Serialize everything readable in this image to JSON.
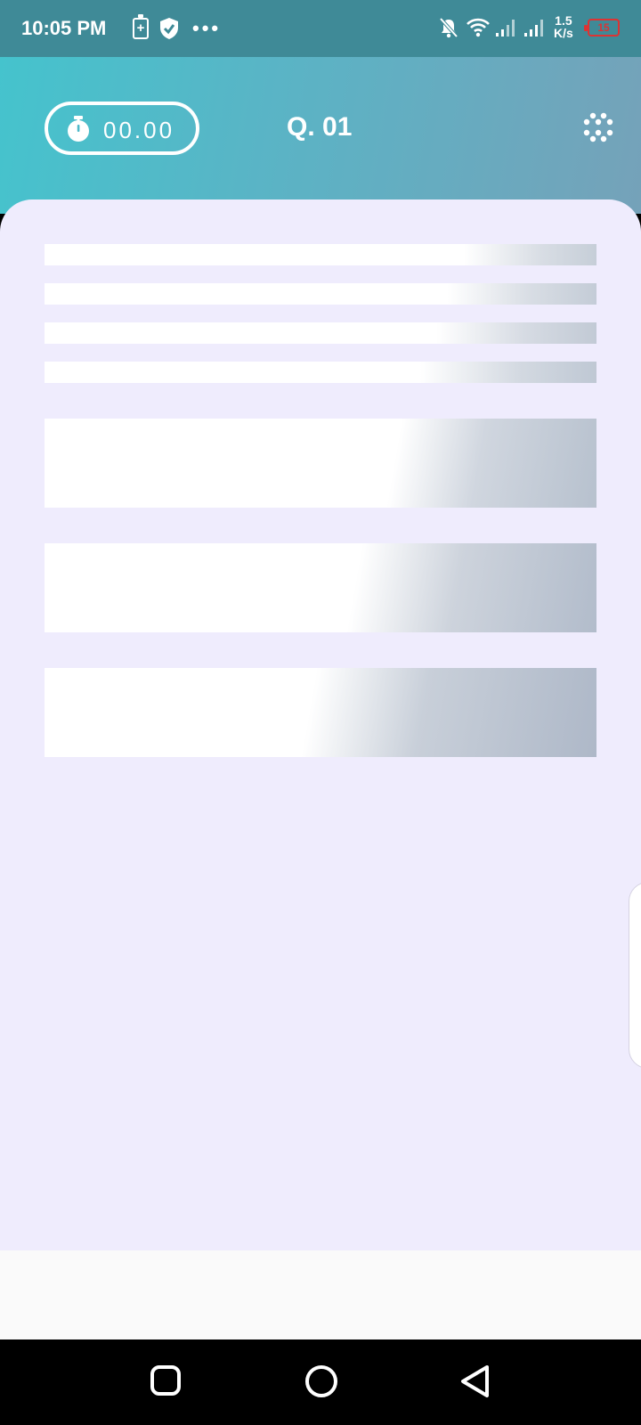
{
  "status_bar": {
    "time": "10:05 PM",
    "battery_saver_symbol": "+",
    "more_dots": "•••",
    "net_speed_value": "1.5",
    "net_speed_unit": "K/s",
    "battery_level": "15",
    "icons": [
      "battery-saver-icon",
      "shield-check-icon",
      "more-dots-icon",
      "bell-off-icon",
      "wifi-icon",
      "signal-icon",
      "signal-icon",
      "battery-icon"
    ],
    "battery_color": "#dd3333"
  },
  "header": {
    "timer_value": "00.00",
    "question_number": "Q. 01",
    "gradient_start": "#45c3cd",
    "gradient_end": "#75a2b9"
  },
  "content": {
    "background": "#efecfd",
    "skeleton_lines": 4,
    "skeleton_options": 3
  },
  "nav_bar": {
    "buttons": [
      "recents-button",
      "home-button",
      "back-button"
    ]
  }
}
